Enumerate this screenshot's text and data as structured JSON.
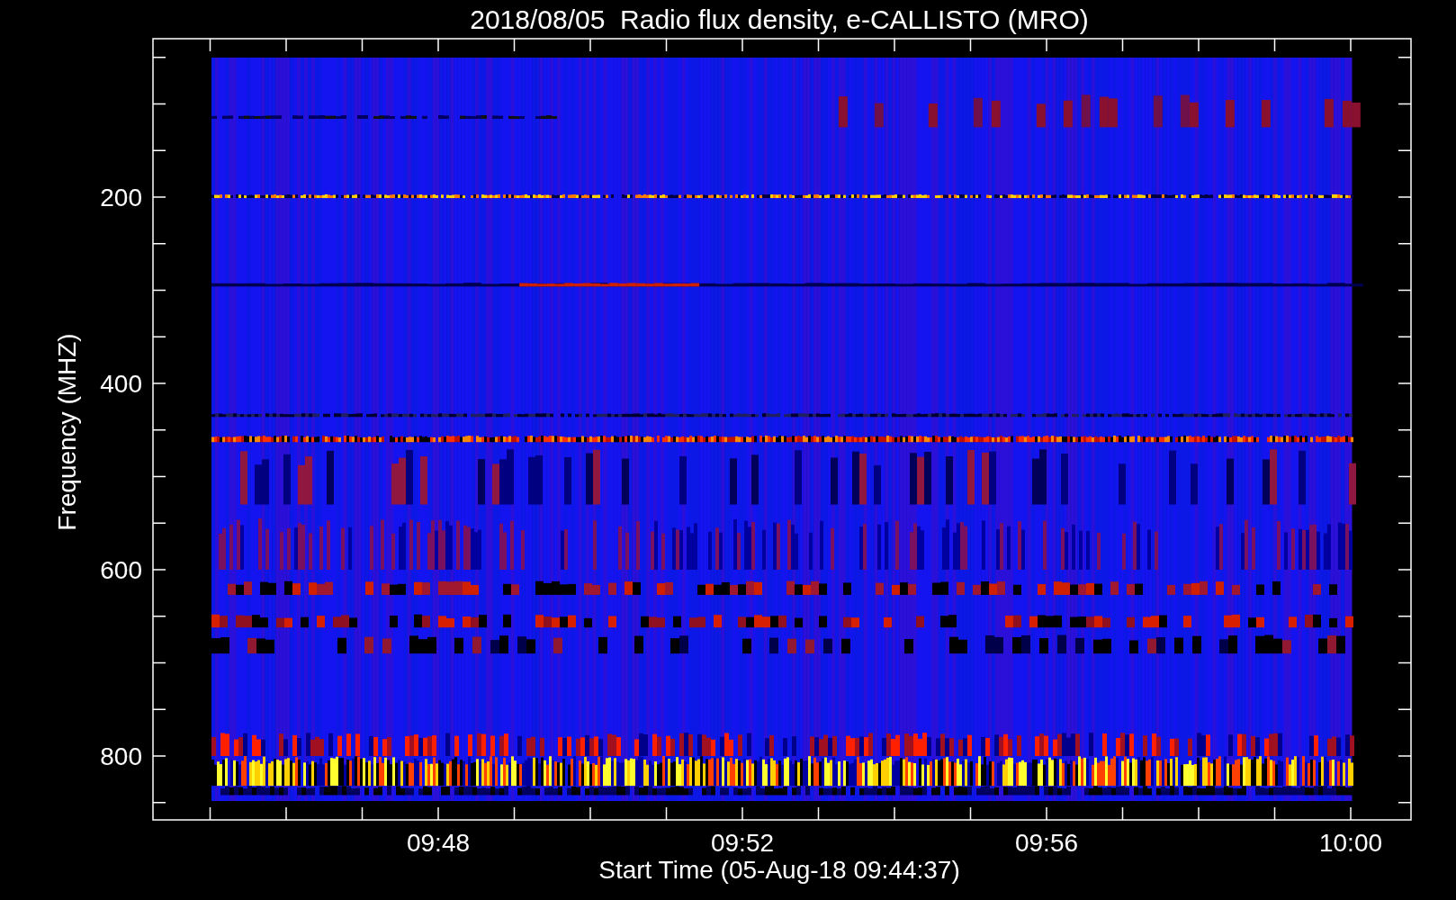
{
  "title": "2018/08/05  Radio flux density, e-CALLISTO (MRO)",
  "y_axis": {
    "label": "Frequency (MHZ)",
    "ticks": [
      "200",
      "400",
      "600",
      "800"
    ]
  },
  "x_axis": {
    "label": "Start Time (05-Aug-18 09:44:37)",
    "ticks": [
      "09:48",
      "09:52",
      "09:56",
      "10:00"
    ]
  }
}
